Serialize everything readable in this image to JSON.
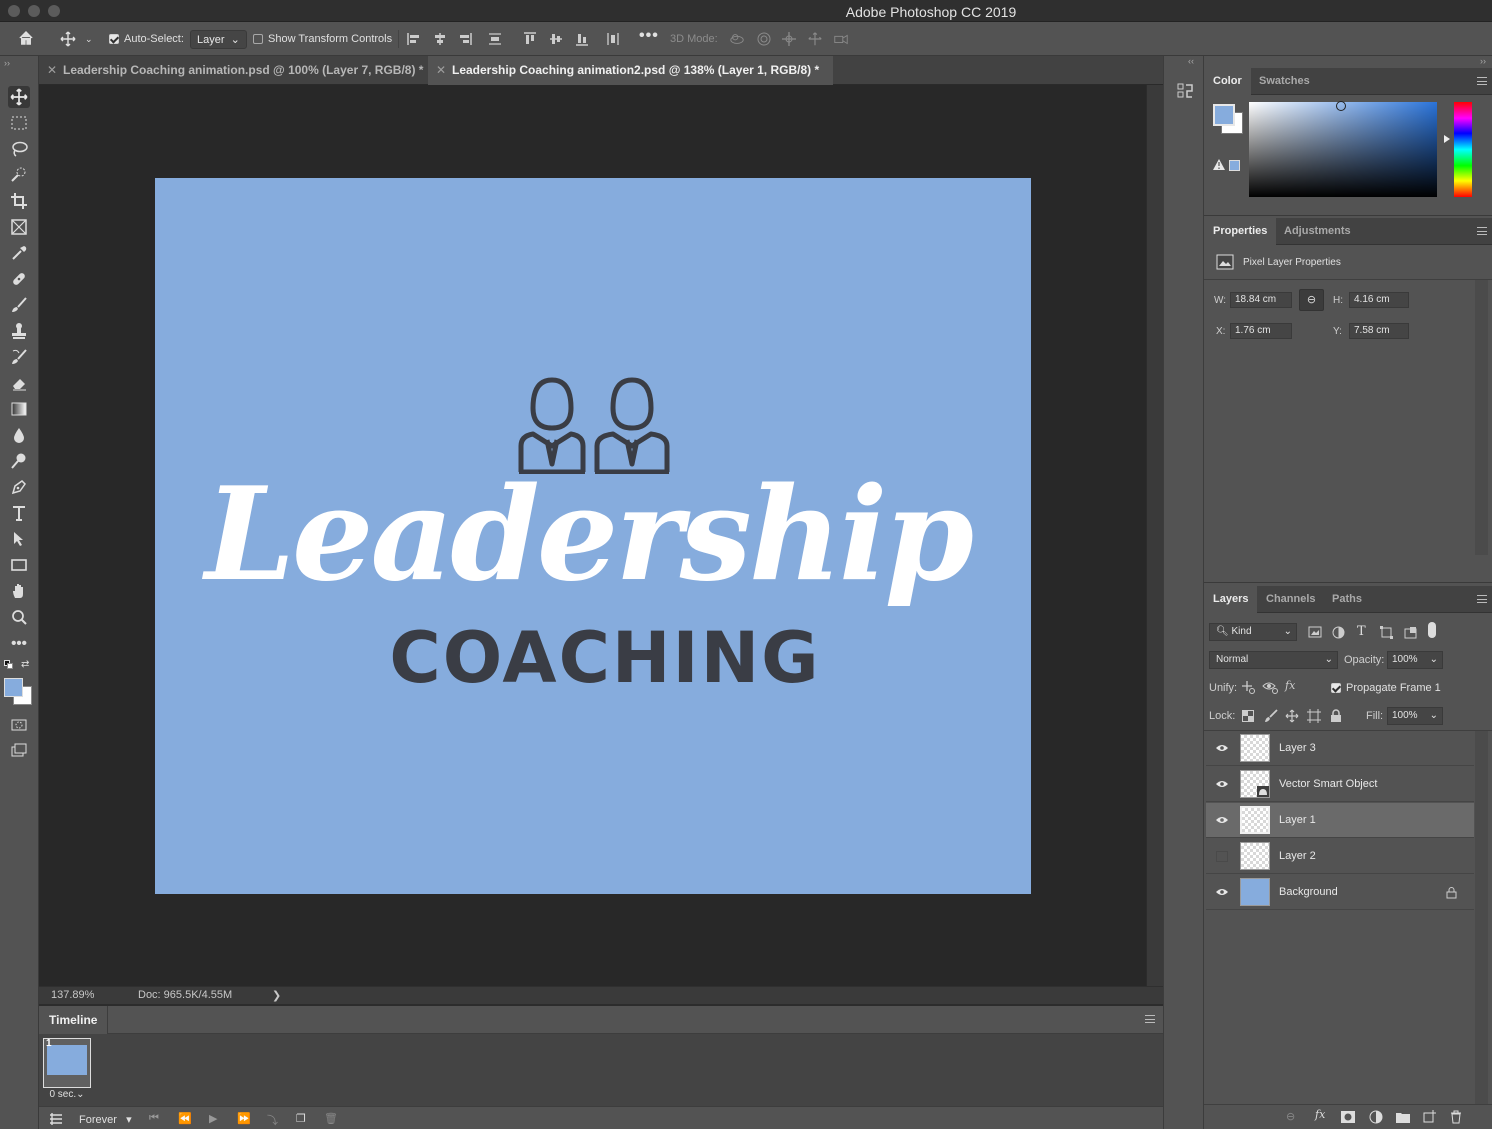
{
  "app": {
    "title": "Adobe Photoshop CC 2019"
  },
  "options_bar": {
    "auto_select_label": "Auto-Select:",
    "auto_select_checked": true,
    "auto_select_target": "Layer",
    "show_transform_label": "Show Transform Controls",
    "show_transform_checked": false,
    "mode3d_label": "3D Mode:"
  },
  "tabs": [
    {
      "label": "Leadership Coaching animation.psd @ 100% (Layer 7, RGB/8) *",
      "active": false
    },
    {
      "label": "Leadership Coaching animation2.psd @ 138% (Layer 1, RGB/8) *",
      "active": true
    }
  ],
  "canvas": {
    "background_color": "#86acdd",
    "headline": "Leadership",
    "subhead": "COACHING",
    "text_color": "#3a3d45"
  },
  "status": {
    "zoom": "137.89%",
    "doc": "Doc: 965.5K/4.55M",
    "arrow": "❯"
  },
  "timeline": {
    "tab": "Timeline",
    "frame_number": "1",
    "frame_delay": "0 sec.",
    "loop": "Forever"
  },
  "color_panel": {
    "tabs": [
      "Color",
      "Swatches"
    ],
    "foreground": "#86acdd",
    "background": "#ffffff"
  },
  "properties_panel": {
    "tabs": [
      "Properties",
      "Adjustments"
    ],
    "header": "Pixel Layer Properties",
    "w_label": "W:",
    "w": "18.84 cm",
    "h_label": "H:",
    "h": "4.16 cm",
    "x_label": "X:",
    "x": "1.76 cm",
    "y_label": "Y:",
    "y": "7.58 cm"
  },
  "layers_panel": {
    "tabs": [
      "Layers",
      "Channels",
      "Paths"
    ],
    "filter": "Kind",
    "blend_mode": "Normal",
    "opacity_label": "Opacity:",
    "opacity": "100%",
    "unify_label": "Unify:",
    "propagate_label": "Propagate Frame 1",
    "lock_label": "Lock:",
    "fill_label": "Fill:",
    "fill": "100%",
    "layers": [
      {
        "name": "Layer 3",
        "visible": true,
        "selected": false
      },
      {
        "name": "Vector Smart Object",
        "visible": true,
        "selected": false
      },
      {
        "name": "Layer 1",
        "visible": true,
        "selected": true
      },
      {
        "name": "Layer 2",
        "visible": false,
        "selected": false
      },
      {
        "name": "Background",
        "visible": true,
        "selected": false,
        "locked": true
      }
    ]
  }
}
